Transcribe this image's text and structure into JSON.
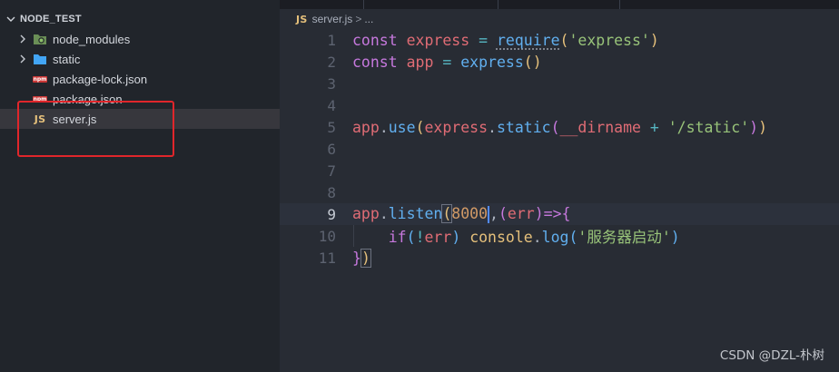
{
  "explorer": {
    "title": "NODE_TEST",
    "items": [
      {
        "label": "node_modules",
        "type": "folder",
        "icon": "node-folder-icon"
      },
      {
        "label": "static",
        "type": "folder",
        "icon": "folder-icon"
      },
      {
        "label": "package-lock.json",
        "type": "file",
        "icon": "npm-icon",
        "badge": "npm"
      },
      {
        "label": "package.json",
        "type": "file",
        "icon": "npm-icon",
        "badge": "npm"
      },
      {
        "label": "server.js",
        "type": "file",
        "icon": "js-icon",
        "badge": "JS",
        "selected": true
      }
    ]
  },
  "breadcrumb": {
    "badge": "JS",
    "file": "server.js",
    "separator": ">",
    "more": "..."
  },
  "editor": {
    "line_numbers": [
      "1",
      "2",
      "3",
      "4",
      "5",
      "6",
      "7",
      "8",
      "9",
      "10",
      "11"
    ],
    "current_line": "9",
    "lines": [
      [
        "const",
        " ",
        "express",
        " = ",
        "require",
        "(",
        "'express'",
        ")"
      ],
      [
        "const",
        " ",
        "app",
        " = ",
        "express",
        "(",
        ")"
      ],
      [],
      [],
      [
        "app",
        ".",
        "use",
        "(",
        "express",
        ".",
        "static",
        "(",
        "__dirname",
        " + ",
        "'/static'",
        ")",
        ")"
      ],
      [],
      [],
      [
        "app",
        ".",
        "listen",
        "(",
        "8000",
        ",",
        "(",
        "err",
        ")",
        "=>",
        "{"
      ],
      [
        "    ",
        "if",
        "(",
        "!",
        "err",
        ") ",
        "console",
        ".",
        "log",
        "(",
        "'服务器启动'",
        ")"
      ],
      [
        "}",
        ")"
      ]
    ]
  },
  "watermark": "CSDN @DZL-朴树",
  "colors": {
    "keyword": "#c678dd",
    "variable": "#e06c75",
    "function": "#61afef",
    "string": "#98c379",
    "number": "#d19a66",
    "highlight_box": "#e0262b"
  }
}
